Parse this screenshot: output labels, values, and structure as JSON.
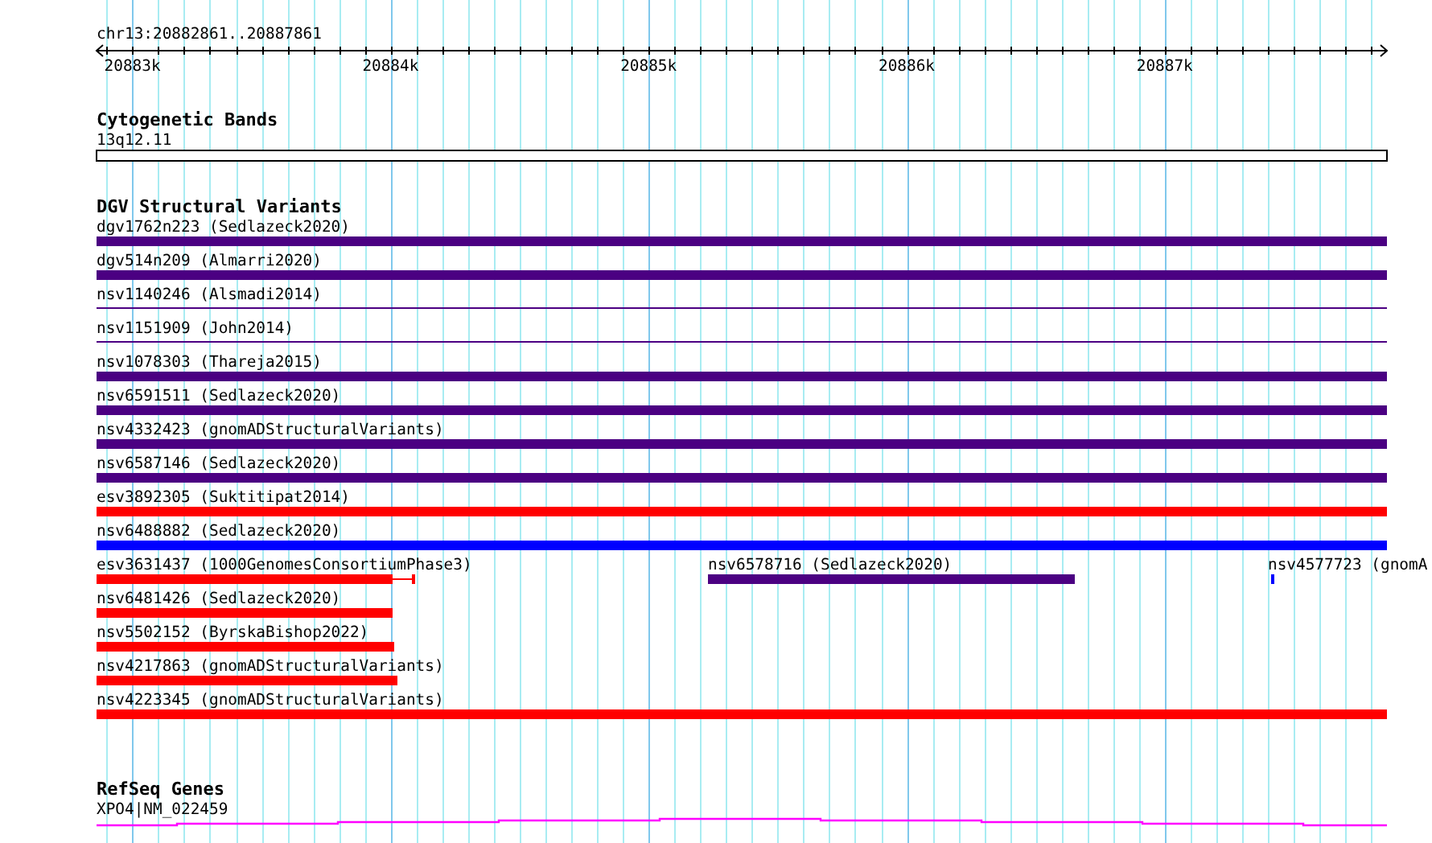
{
  "ruler": {
    "location": "chr13:20882861..20887861",
    "ticks": [
      {
        "label": "20883k"
      },
      {
        "label": "20884k"
      },
      {
        "label": "20885k"
      },
      {
        "label": "20886k"
      },
      {
        "label": "20887k"
      }
    ]
  },
  "cytogenetic_bands": {
    "title": "Cytogenetic Bands",
    "bands": [
      {
        "name": "13q12.11"
      }
    ]
  },
  "dgv_structural_variants": {
    "title": "DGV Structural Variants",
    "lanes": [
      {
        "features": [
          {
            "label": "dgv1762n223 (Sedlazeck2020)",
            "kind": "bar",
            "color": "#4b0082"
          }
        ]
      },
      {
        "features": [
          {
            "label": "dgv514n209 (Almarri2020)",
            "kind": "bar",
            "color": "#4b0082"
          }
        ]
      },
      {
        "features": [
          {
            "label": "nsv1140246 (Alsmadi2014)",
            "kind": "line",
            "color": "#4b0082"
          }
        ]
      },
      {
        "features": [
          {
            "label": "nsv1151909 (John2014)",
            "kind": "line",
            "color": "#4b0082"
          }
        ]
      },
      {
        "features": [
          {
            "label": "nsv1078303 (Thareja2015)",
            "kind": "bar",
            "color": "#4b0082"
          }
        ]
      },
      {
        "features": [
          {
            "label": "nsv6591511 (Sedlazeck2020)",
            "kind": "bar",
            "color": "#4b0082"
          }
        ]
      },
      {
        "features": [
          {
            "label": "nsv4332423 (gnomADStructuralVariants)",
            "kind": "bar",
            "color": "#4b0082"
          }
        ]
      },
      {
        "features": [
          {
            "label": "nsv6587146 (Sedlazeck2020)",
            "kind": "bar",
            "color": "#4b0082"
          }
        ]
      },
      {
        "features": [
          {
            "label": "esv3892305 (Suktitipat2014)",
            "kind": "bar",
            "color": "#ff0000"
          }
        ]
      },
      {
        "features": [
          {
            "label": "nsv6488882 (Sedlazeck2020)",
            "kind": "bar",
            "color": "#0000ff"
          }
        ]
      },
      {
        "features": [
          {
            "label": "esv3631437 (1000GenomesConsortiumPhase3)",
            "kind": "whisker_bar",
            "color": "#ff0000"
          },
          {
            "label": "nsv6578716 (Sedlazeck2020)",
            "kind": "bar",
            "color": "#4b0082"
          },
          {
            "label": "nsv4577723 (gnomA",
            "kind": "bar",
            "color": "#0000ff"
          }
        ]
      },
      {
        "features": [
          {
            "label": "nsv6481426 (Sedlazeck2020)",
            "kind": "bar",
            "color": "#ff0000"
          }
        ]
      },
      {
        "features": [
          {
            "label": "nsv5502152 (ByrskaBishop2022)",
            "kind": "bar",
            "color": "#ff0000"
          }
        ]
      },
      {
        "features": [
          {
            "label": "nsv4217863 (gnomADStructuralVariants)",
            "kind": "bar",
            "color": "#ff0000"
          }
        ]
      },
      {
        "features": [
          {
            "label": "nsv4223345 (gnomADStructuralVariants)",
            "kind": "bar",
            "color": "#ff0000"
          }
        ]
      }
    ]
  },
  "refseq_genes": {
    "title": "RefSeq Genes",
    "genes": [
      {
        "name": "XPO4|NM_022459"
      }
    ]
  }
}
